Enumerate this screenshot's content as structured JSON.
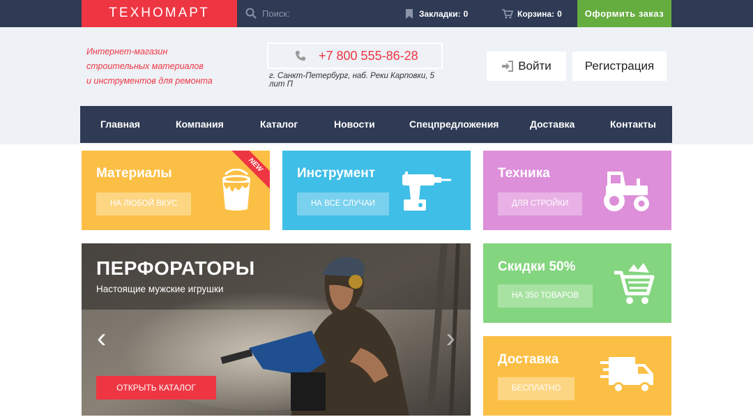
{
  "topbar": {
    "logo": "ТЕХНОМАРТ",
    "search_placeholder": "Поиск:",
    "bookmarks_label": "Закладки:",
    "bookmarks_count": "0",
    "cart_label": "Корзина:",
    "cart_count": "0",
    "order_label": "Оформить заказ"
  },
  "header": {
    "tagline": [
      "Интернет-магазин",
      "строительных материалов",
      "и инструментов для ремонта"
    ],
    "phone": "+7 800 555-86-28",
    "address": "г. Санкт-Петербург, наб. Реки Карповки, 5 лит П",
    "login_label": "Войти",
    "register_label": "Регистрация"
  },
  "nav": {
    "items": [
      "Главная",
      "Компания",
      "Каталог",
      "Новости",
      "Спецпредложения",
      "Доставка",
      "Контакты"
    ]
  },
  "tiles": {
    "materials": {
      "title": "Материалы",
      "button": "НА ЛЮБОЙ ВКУС",
      "ribbon": "NEW",
      "icon": "paint-bucket-icon"
    },
    "tools": {
      "title": "Инструмент",
      "button": "НА ВСЕ СЛУЧАИ",
      "icon": "drill-icon"
    },
    "tech": {
      "title": "Техника",
      "button": "ДЛЯ СТРОЙКИ",
      "icon": "tractor-icon"
    },
    "sale": {
      "title": "Скидки 50%",
      "button": "НА 350 ТОВАРОВ",
      "icon": "cart-icon"
    },
    "delivery": {
      "title": "Доставка",
      "button": "БЕСПЛАТНО",
      "icon": "truck-icon"
    }
  },
  "hero": {
    "title": "ПЕРФОРАТОРЫ",
    "subtitle": "Настоящие мужские игрушки",
    "button": "ОТКРЫТЬ КАТАЛОГ",
    "prev": "‹",
    "next": "›"
  },
  "colors": {
    "dark": "#2f3b55",
    "red": "#ee3643",
    "green": "#66ad40",
    "yellow": "#fcbf45",
    "blue": "#3fbee7",
    "purple": "#dd8fd9",
    "light_green": "#84d57f"
  }
}
